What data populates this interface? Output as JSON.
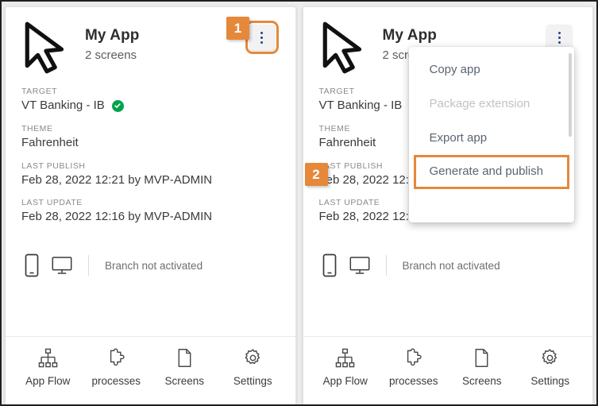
{
  "app": {
    "title": "My App",
    "screens": "2 screens",
    "cursor_icon": "cursor-arrow-icon",
    "kebab_icon": "kebab-menu-icon"
  },
  "fields": [
    {
      "label": "TARGET",
      "value": "VT Banking - IB",
      "status_icon": "check-circle-icon",
      "status_color": "#00a24c"
    },
    {
      "label": "THEME",
      "value": "Fahrenheit"
    },
    {
      "label": "LAST PUBLISH",
      "value": "Feb 28, 2022 12:21 by MVP-ADMIN"
    },
    {
      "label": "LAST UPDATE",
      "value": "Feb 28, 2022 12:16 by MVP-ADMIN"
    }
  ],
  "devices": {
    "phone_icon": "mobile-phone-icon",
    "desktop_icon": "desktop-monitor-icon",
    "branch_text": "Branch not activated"
  },
  "toolbar": [
    {
      "label": "App Flow",
      "icon": "sitemap-icon"
    },
    {
      "label": "processes",
      "icon": "puzzle-piece-icon"
    },
    {
      "label": "Screens",
      "icon": "document-page-icon"
    },
    {
      "label": "Settings",
      "icon": "gear-icon"
    }
  ],
  "menu": {
    "items": [
      {
        "label": "Copy app",
        "state": "enabled"
      },
      {
        "label": "Package extension",
        "state": "disabled"
      },
      {
        "label": "Export app",
        "state": "enabled"
      },
      {
        "label": "Generate and publish",
        "state": "selected"
      }
    ]
  },
  "annotations": {
    "step1": "1",
    "step2": "2",
    "accent_color": "#e5883a"
  }
}
